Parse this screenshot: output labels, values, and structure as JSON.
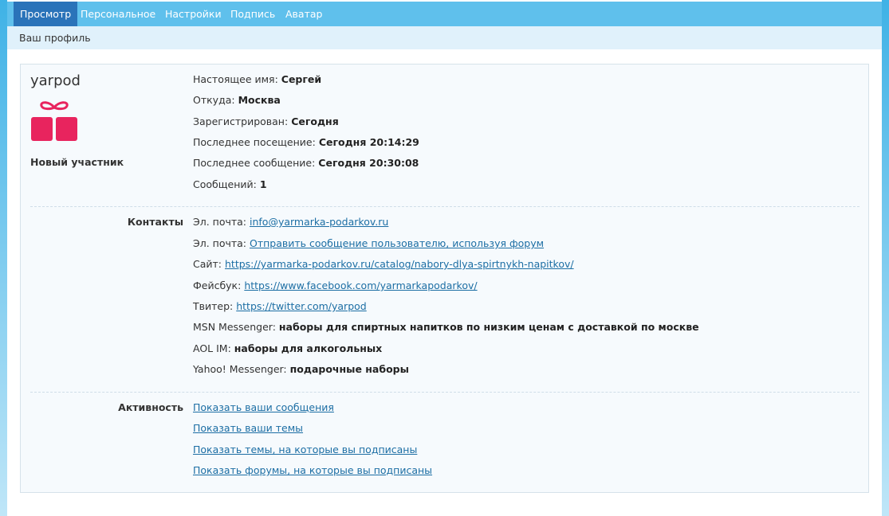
{
  "tabs": [
    "Просмотр",
    "Персональное",
    "Настройки",
    "Подпись",
    "Аватар"
  ],
  "subtitle": "Ваш профиль",
  "profile": {
    "username": "yarpod",
    "avatar_icon": "gift-icon",
    "rank": "Новый участник",
    "details": [
      {
        "label": "Настоящее имя:",
        "value": "Сергей"
      },
      {
        "label": "Откуда:",
        "value": "Москва"
      },
      {
        "label": "Зарегистрирован:",
        "value": "Сегодня"
      },
      {
        "label": "Последнее посещение:",
        "value": "Сегодня 20:14:29"
      },
      {
        "label": "Последнее сообщение:",
        "value": "Сегодня 20:30:08"
      },
      {
        "label": "Сообщений:",
        "value": "1"
      }
    ]
  },
  "contacts": {
    "heading": "Контакты",
    "email": {
      "label": "Эл. почта:",
      "value": "info@yarmarka-podarkov.ru"
    },
    "email_form": {
      "label": "Эл. почта:",
      "value": "Отправить сообщение пользователю, используя форум"
    },
    "site": {
      "label": "Сайт:",
      "value": "https://yarmarka-podarkov.ru/catalog/nabory-dlya-spirtnykh-napitkov/"
    },
    "facebook": {
      "label": "Фейсбук:",
      "value": "https://www.facebook.com/yarmarkapodarkov/"
    },
    "twitter": {
      "label": "Твитер:",
      "value": "https://twitter.com/yarpod"
    },
    "msn": {
      "label": "MSN Messenger:",
      "value": "наборы для спиртных напитков по низким ценам с доставкой по москве"
    },
    "aol": {
      "label": "AOL IM:",
      "value": "наборы для алкогольных"
    },
    "yahoo": {
      "label": "Yahoo! Messenger:",
      "value": "подарочные наборы"
    }
  },
  "activity": {
    "heading": "Активность",
    "links": [
      "Показать ваши сообщения",
      "Показать ваши темы",
      "Показать темы, на которые вы подписаны",
      "Показать форумы, на которые вы подписаны"
    ]
  },
  "colors": {
    "tab_bar": "#5fc0ec",
    "tab_active": "#2a73b9",
    "link": "#1c6ea4",
    "avatar": "#e8245e"
  }
}
